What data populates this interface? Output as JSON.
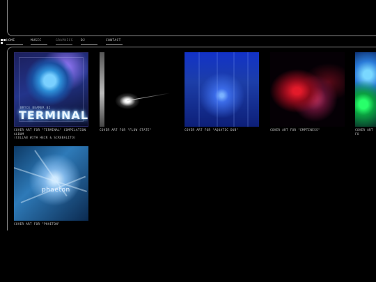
{
  "nav": {
    "items": [
      {
        "label": "HOME"
      },
      {
        "label": "MUSIC"
      },
      {
        "label": "GRAPHICS"
      },
      {
        "label": "DJ"
      },
      {
        "label": "CONTACT"
      }
    ],
    "active": "GRAPHICS"
  },
  "gallery": {
    "items": [
      {
        "caption": "COVER ART FOR \"TERMINAL\" COMPILATION ALBUM\n(COLLAB WITH HEIR & SCREBALITO)",
        "art_text": "TERMINAL",
        "art_subtext": "BRYCE BEAMER 02"
      },
      {
        "caption": "COVER ART FOR \"FLOW STATE\""
      },
      {
        "caption": "COVER ART FOR \"AQUATIC DUB\""
      },
      {
        "caption": "COVER ART FOR \"EMPTINESS\""
      },
      {
        "caption": "COVER ART FO"
      },
      {
        "caption": "COVER ART FOR \"PHAETON\"",
        "art_text": "phaeton"
      }
    ]
  },
  "colors": {
    "background": "#000000",
    "frame_line": "#8a8a8a",
    "text": "#c8c8c8"
  }
}
